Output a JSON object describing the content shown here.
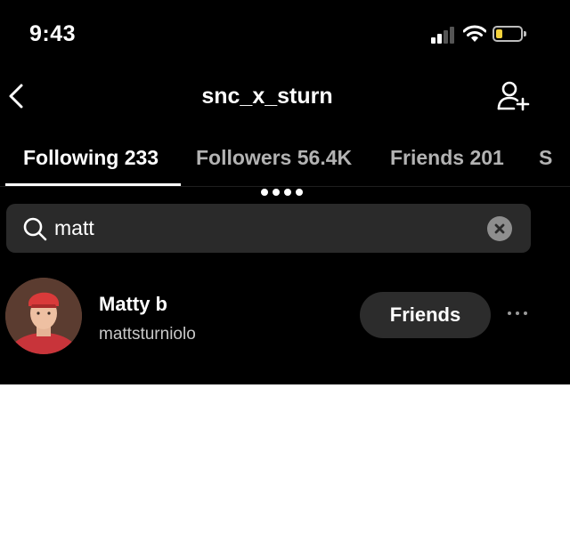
{
  "status_bar": {
    "time": "9:43"
  },
  "header": {
    "username": "snc_x_sturn"
  },
  "tabs": [
    {
      "label": "Following 233"
    },
    {
      "label": "Followers 56.4K"
    },
    {
      "label": "Friends 201"
    },
    {
      "label": "S"
    }
  ],
  "search": {
    "value": "matt"
  },
  "results": [
    {
      "display_name": "Matty b",
      "handle": "mattsturniolo",
      "action_label": "Friends"
    }
  ],
  "colors": {
    "background": "#000000",
    "search_bg": "#2a2a2a",
    "button_bg": "#2c2c2c",
    "battery": "#f6d33c"
  },
  "icons": {
    "back": "chevron-left-icon",
    "add_user": "add-user-icon",
    "search": "search-icon",
    "clear": "clear-icon",
    "more": "more-horizontal-icon"
  }
}
